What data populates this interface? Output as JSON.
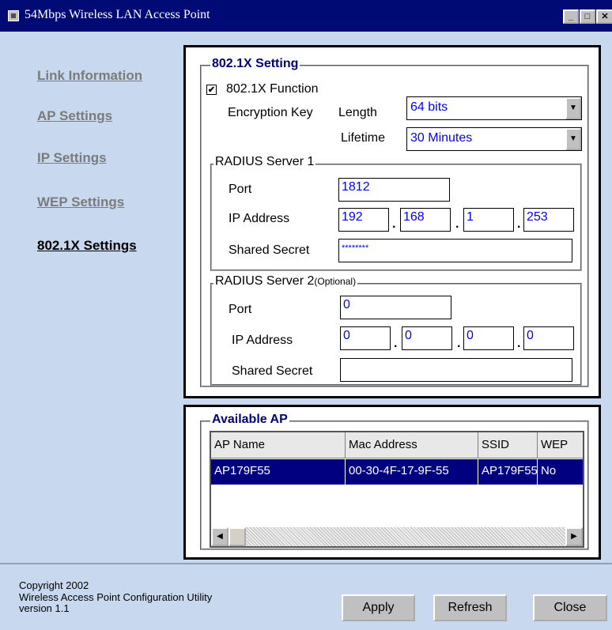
{
  "window": {
    "title": "54Mbps Wireless LAN Access Point",
    "min_glyph": "_",
    "max_glyph": "□",
    "close_glyph": "✕"
  },
  "nav": {
    "items": [
      {
        "label": "Link Information",
        "active": false
      },
      {
        "label": "AP Settings",
        "active": false
      },
      {
        "label": "IP Settings",
        "active": false
      },
      {
        "label": "WEP Settings",
        "active": false
      },
      {
        "label": "802.1X Settings",
        "active": true
      }
    ]
  },
  "dot1x": {
    "group_title": "802.1X Setting",
    "function_label": "802.1X Function",
    "function_checked": true,
    "enc_key_label": "Encryption Key",
    "length_label": "Length",
    "length_value": "64 bits",
    "lifetime_label": "Lifetime",
    "lifetime_value": "30 Minutes",
    "radius1": {
      "title": "RADIUS Server 1",
      "port_label": "Port",
      "port": "1812",
      "ip_label": "IP Address",
      "ip": [
        "192",
        "168",
        "1",
        "253"
      ],
      "secret_label": "Shared Secret",
      "secret": "********"
    },
    "radius2": {
      "title": "RADIUS Server 2",
      "optional": "(Optional)",
      "port_label": "Port",
      "port": "0",
      "ip_label": "IP Address",
      "ip": [
        "0",
        "0",
        "0",
        "0"
      ],
      "secret_label": "Shared Secret",
      "secret": ""
    }
  },
  "available": {
    "title": "Available AP",
    "columns": [
      "AP Name",
      "Mac Address",
      "SSID",
      "WEP"
    ],
    "rows": [
      [
        "AP179F55",
        "00-30-4F-17-9F-55",
        "AP179F55",
        "No"
      ]
    ]
  },
  "footer": {
    "copyright": "Copyright 2002",
    "product": "Wireless Access Point Configuration Utility",
    "version": "version 1.1",
    "apply": "Apply",
    "refresh": "Refresh",
    "close": "Close"
  },
  "colors": {
    "titlebar": "#000a74",
    "background": "#c7d8ef",
    "selection": "#000080",
    "field_text": "#0000ff"
  }
}
